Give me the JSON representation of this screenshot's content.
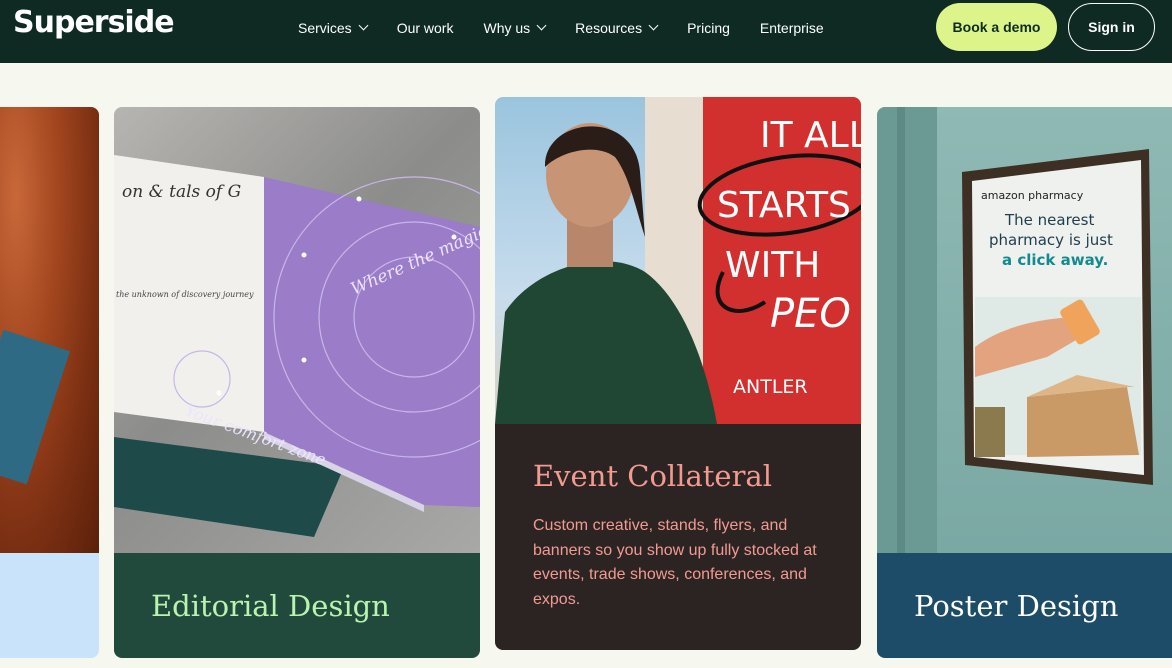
{
  "brand": {
    "logo": "Superside"
  },
  "nav": {
    "items": [
      {
        "label": "Services",
        "has_dropdown": true
      },
      {
        "label": "Our work",
        "has_dropdown": false
      },
      {
        "label": "Why us",
        "has_dropdown": true
      },
      {
        "label": "Resources",
        "has_dropdown": true
      },
      {
        "label": "Pricing",
        "has_dropdown": false
      },
      {
        "label": "Enterprise",
        "has_dropdown": false
      }
    ],
    "book_demo": "Book a demo",
    "sign_in": "Sign in"
  },
  "cards": [
    {
      "title": ""
    },
    {
      "title": "Editorial Design",
      "image_text": {
        "page_left": "on & tals of G",
        "page_left_small": "the unknown of discovery journey",
        "page_right": "Where the magic happ",
        "page_bottom": "Your comfort zone"
      }
    },
    {
      "title": "Event Collateral",
      "description": "Custom creative, stands, flyers, and banners so you show up fully stocked at events, trade shows, conferences, and expos.",
      "image_text": {
        "sign_line1": "IT ALL",
        "sign_line2": "STARTS",
        "sign_line3": "WITH",
        "sign_line4": "PEO",
        "sign_brand": "ANTLER"
      }
    },
    {
      "title": "Poster Design",
      "image_text": {
        "brand": "amazon pharmacy",
        "line1": "The nearest",
        "line2": "pharmacy is just",
        "line3": "a click away."
      }
    }
  ],
  "colors": {
    "nav_bg": "#0e2a22",
    "demo_button": "#dcf48a",
    "editorial_bar": "#224a3c",
    "editorial_text": "#b8f3b0",
    "event_bar": "#2b2423",
    "event_text": "#f29a90",
    "poster_bar": "#1c4c67",
    "page_bg": "#f6f8ef"
  }
}
